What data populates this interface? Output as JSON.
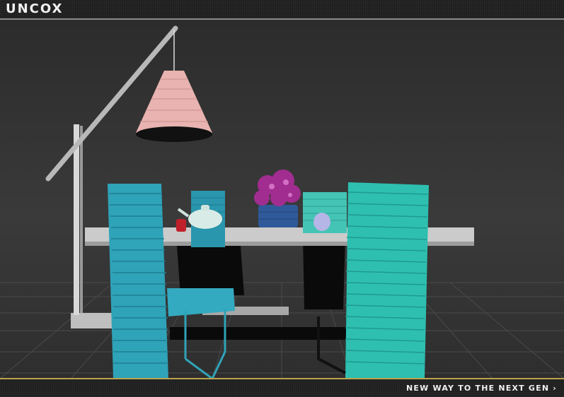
{
  "header": {
    "brand": "UNCOX"
  },
  "footer": {
    "tagline": "NEW WAY TO THE NEXT GEN",
    "arrow": "›"
  },
  "scene": {
    "icons": [
      "floor-lamp",
      "lamp-shade",
      "dining-table",
      "chair",
      "teapot",
      "mug",
      "flower-basket",
      "sugar-bowl"
    ],
    "colors": {
      "chair": "#2fa3b8",
      "chair_back_right": "#2ebfb0",
      "lamp_shade": "#e8b3b0",
      "table_top": "#c9c9c9",
      "flowers": "#a02d8f",
      "basket": "#2f5a9a",
      "accent_line": "#bba24a"
    }
  }
}
